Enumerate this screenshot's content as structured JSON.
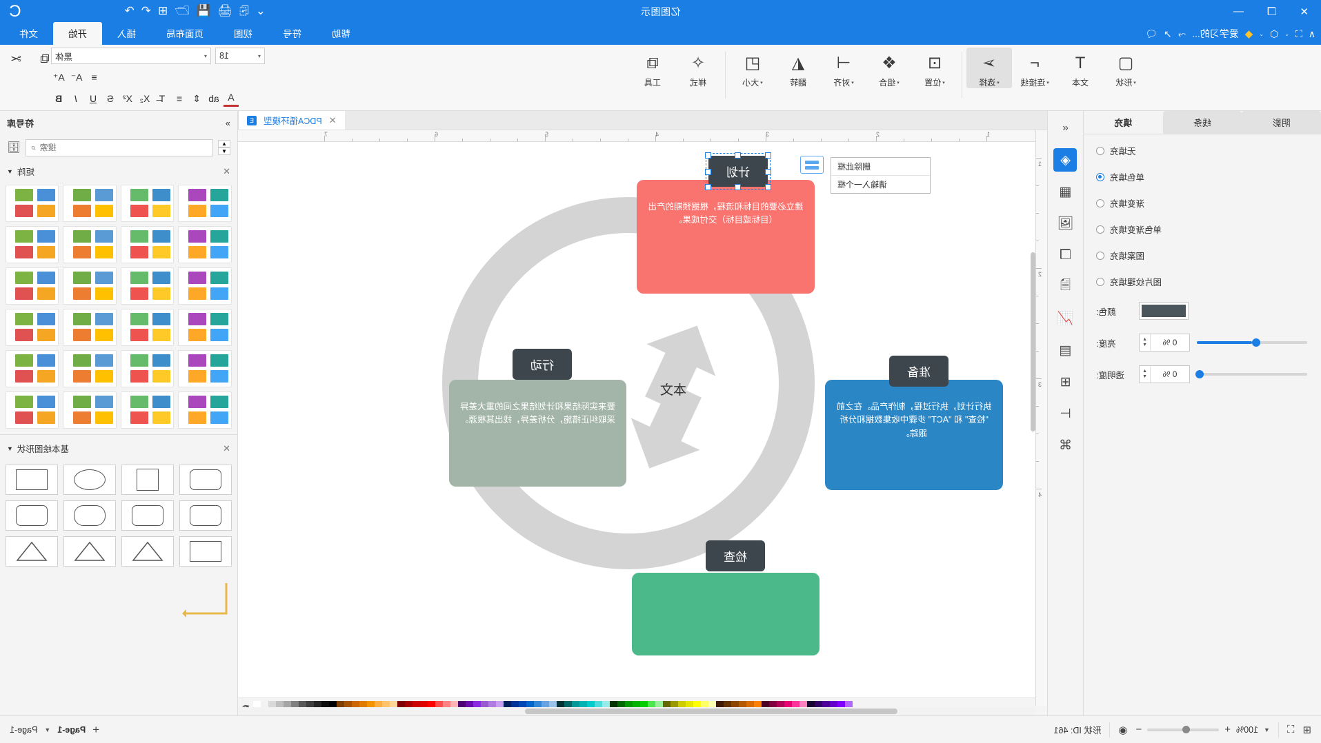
{
  "window": {
    "title": "亿图图示",
    "controls": [
      "✕",
      "❐",
      "—"
    ],
    "right_icons": [
      "⌄",
      "⎘",
      "🖨",
      "💾",
      "🗁",
      "⊞",
      "↶",
      "↷"
    ],
    "account_icon": "C"
  },
  "quick_access": {
    "items": [
      "∧",
      "⛶",
      "⌄",
      "⬡",
      "⌄",
      "◆",
      "爱学习的...",
      "⤳",
      "↗",
      "🗨"
    ],
    "help_label": "帮助"
  },
  "tabs": [
    {
      "label": "文件",
      "active": false
    },
    {
      "label": "开始",
      "active": true
    },
    {
      "label": "插入",
      "active": false
    },
    {
      "label": "页面布局",
      "active": false
    },
    {
      "label": "视图",
      "active": false
    },
    {
      "label": "符号",
      "active": false
    },
    {
      "label": "帮助",
      "active": false
    }
  ],
  "ribbon": {
    "tools": [
      {
        "label": "形状",
        "icon": "▢",
        "caret": true,
        "selected": false
      },
      {
        "label": "文本",
        "icon": "T",
        "caret": false,
        "selected": false
      },
      {
        "label": "连接线",
        "icon": "⌐",
        "caret": true,
        "selected": false
      },
      {
        "label": "选择",
        "icon": "➢",
        "caret": true,
        "selected": true
      },
      {
        "label": "位置",
        "icon": "⊡",
        "caret": true,
        "selected": false
      },
      {
        "label": "组合",
        "icon": "❖",
        "caret": true,
        "selected": false
      },
      {
        "label": "对齐",
        "icon": "⊣",
        "caret": true,
        "selected": false
      },
      {
        "label": "翻转",
        "icon": "◭",
        "caret": false,
        "selected": false
      },
      {
        "label": "大小",
        "icon": "◰",
        "caret": true,
        "selected": false
      },
      {
        "label": "样式",
        "icon": "✧",
        "caret": false,
        "selected": false
      },
      {
        "label": "工具",
        "icon": "⧉",
        "caret": false,
        "selected": false
      }
    ],
    "font_name": "黑体",
    "font_size": "18",
    "format_buttons_row1": [
      "A⁺",
      "A⁻",
      "≡"
    ],
    "format_buttons_row2": [
      "B",
      "I",
      "U",
      "S",
      "X²",
      "X₂",
      "T̶",
      "≡",
      "⇕",
      "ab",
      "A"
    ],
    "right_buttons": [
      "✂",
      "⧉",
      "🗐",
      "✎"
    ]
  },
  "format_panel": {
    "tabs": [
      {
        "label": "填充",
        "active": true
      },
      {
        "label": "线条",
        "active": false
      },
      {
        "label": "阴影",
        "active": false
      }
    ],
    "fill_options": [
      {
        "label": "无填充",
        "selected": false
      },
      {
        "label": "单色填充",
        "selected": true
      },
      {
        "label": "渐变填充",
        "selected": false
      },
      {
        "label": "单色渐变填充",
        "selected": false
      },
      {
        "label": "图案填充",
        "selected": false
      },
      {
        "label": "图片纹理填充",
        "selected": false
      }
    ],
    "color_label": "颜色:",
    "color_value": "#4a555c",
    "brightness_label": "亮度:",
    "brightness_value": "0 %",
    "transparency_label": "透明度:",
    "transparency_value": "0 %"
  },
  "side_strip_icons": [
    "collapse-icon",
    "fill-format-icon",
    "shapes-grid-icon",
    "image-icon",
    "layers-icon",
    "document-icon",
    "chart-icon",
    "table-icon",
    "crop-icon",
    "align-icon",
    "connect-icon"
  ],
  "document_tab": {
    "name": "PDCA循环模型",
    "close": "✕"
  },
  "canvas": {
    "ruler_h_labels": [
      "1",
      "2",
      "3",
      "4",
      "5",
      "6",
      "7"
    ],
    "ruler_v_labels": [
      "1",
      "2",
      "3",
      "4"
    ],
    "center_text": "本文",
    "tooltip_lines": [
      "请输入一个框",
      "删除此框"
    ],
    "nodes": [
      {
        "key": "plan",
        "tag": "计划",
        "body": "建立必要的目标和流程，根据预期的产出（目标或目标）交付成果。",
        "color": "#f9746f",
        "selected": true
      },
      {
        "key": "do",
        "tag": "行动",
        "body": "要来实际结果和计划结果之间的重大差异采取纠正措施，分析差异，找出其根源。",
        "color": "#a3b5a9",
        "selected": false
      },
      {
        "key": "check",
        "tag": "检查",
        "body": "",
        "color": "#4cb98b",
        "selected": false
      },
      {
        "key": "act",
        "tag": "准备",
        "body": "执行计划，执行过程，制作产品。在之前 \"检查\" 和 \"ACT\" 步骤中收集数据和分析跟踪。",
        "color": "#2b86c5",
        "selected": false
      }
    ]
  },
  "library": {
    "title": "符号库",
    "search_placeholder": "搜索",
    "sections": [
      {
        "label": "矩阵",
        "close": "✕"
      },
      {
        "label": "基本绘图形状",
        "close": "✕"
      }
    ]
  },
  "status_bar": {
    "page_name_left": "Page-1",
    "page_name_right": "Page-1",
    "add_page": "+",
    "object_id": "形状 ID: 461",
    "zoom": "100%",
    "zoom_minus": "−",
    "zoom_plus": "+",
    "fit_icon": "⛶",
    "fullpage_icon": "⊞"
  },
  "palette_colors": [
    "#ffffff",
    "#f2f2f2",
    "#d9d9d9",
    "#bfbfbf",
    "#a6a6a6",
    "#808080",
    "#595959",
    "#404040",
    "#262626",
    "#0d0d0d",
    "#000000",
    "#7f3f00",
    "#a65300",
    "#cc6600",
    "#e07b00",
    "#f49300",
    "#ffae42",
    "#ffc46b",
    "#ffd699",
    "#7f0000",
    "#a60000",
    "#cc0000",
    "#e00000",
    "#ff0000",
    "#ff4d4d",
    "#ff8080",
    "#ffb3b3",
    "#4c0073",
    "#6a0dad",
    "#8a2be2",
    "#9b59d0",
    "#b07ce0",
    "#c9a0ef",
    "#002060",
    "#003399",
    "#0047b3",
    "#0066cc",
    "#3385d6",
    "#66a3e0",
    "#99c2eb",
    "#003333",
    "#006666",
    "#009999",
    "#00b3b3",
    "#00cccc",
    "#4ddbdb",
    "#99ebeb",
    "#003300",
    "#006600",
    "#009900",
    "#00b300",
    "#00cc00",
    "#4de64d",
    "#99f099",
    "#666600",
    "#999900",
    "#cccc00",
    "#e6e600",
    "#ffff00",
    "#ffff66",
    "#ffffb3",
    "#401a00",
    "#663300",
    "#8c4600",
    "#b35900",
    "#d96c00",
    "#ff8000",
    "#4d0026",
    "#800040",
    "#b30059",
    "#e60073",
    "#ff3399",
    "#ff80bf",
    "#1a0033",
    "#330066",
    "#4d0099",
    "#6600cc",
    "#8000ff",
    "#b366ff"
  ]
}
